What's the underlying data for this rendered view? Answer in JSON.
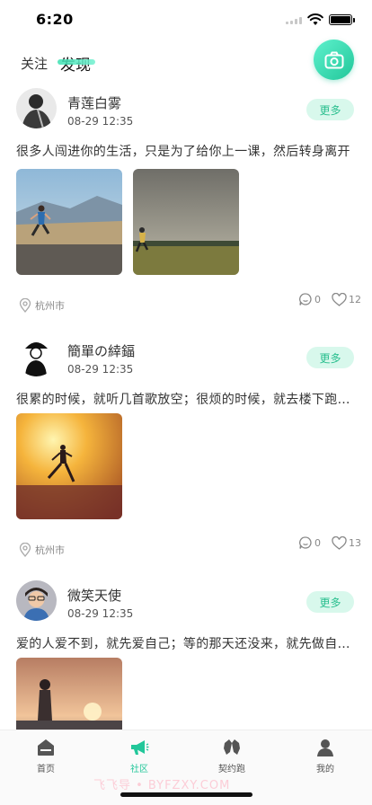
{
  "status_bar": {
    "time": "6:20"
  },
  "header": {
    "tabs": [
      {
        "label": "关注"
      },
      {
        "label": "发现"
      }
    ]
  },
  "posts": [
    {
      "username": "青莲白雾",
      "time": "08-29 12:35",
      "more_label": "更多",
      "content": "很多人闯进你的生活，只是为了给你上一课，然后转身离开",
      "location": "杭州市",
      "comments": "0",
      "likes": "12"
    },
    {
      "username": "簡單の緈鍢",
      "time": "08-29 12:35",
      "more_label": "更多",
      "content": "很累的时候，就听几首歌放空；很烦的时候，就去楼下跑…",
      "location": "杭州市",
      "comments": "0",
      "likes": "13"
    },
    {
      "username": "微笑天使",
      "time": "08-29 12:35",
      "more_label": "更多",
      "content": "爱的人爱不到，就先爱自己；等的那天还没来，就先做自…"
    }
  ],
  "bottom_nav": {
    "items": [
      {
        "label": "首页",
        "icon": "home-icon"
      },
      {
        "label": "社区",
        "icon": "megaphone-icon"
      },
      {
        "label": "契约跑",
        "icon": "handshake-icon"
      },
      {
        "label": "我的",
        "icon": "user-icon"
      }
    ]
  },
  "watermark": "飞飞导 • BYFZXY.COM",
  "colors": {
    "accent": "#22c79a",
    "accent_light": "#d8f8ec"
  }
}
